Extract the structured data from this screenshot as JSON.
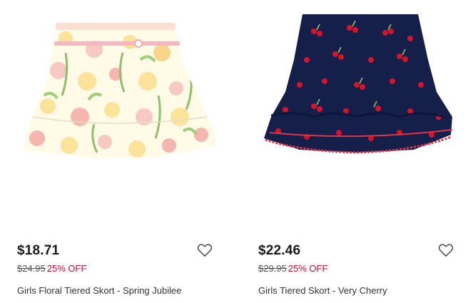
{
  "products": [
    {
      "image": "floral-skort-image",
      "price": "$18.71",
      "was_price": "$24.95",
      "discount": "25% OFF",
      "name": "Girls Floral Tiered Skort - Spring Jubilee"
    },
    {
      "image": "cherry-skort-image",
      "price": "$22.46",
      "was_price": "$29.95",
      "discount": "25% OFF",
      "name": "Girls Tiered Skort - Very Cherry"
    }
  ],
  "icons": {
    "favorite": "heart-outline-icon"
  },
  "colors": {
    "discount": "#c8102e",
    "price": "#1a1a1a"
  }
}
